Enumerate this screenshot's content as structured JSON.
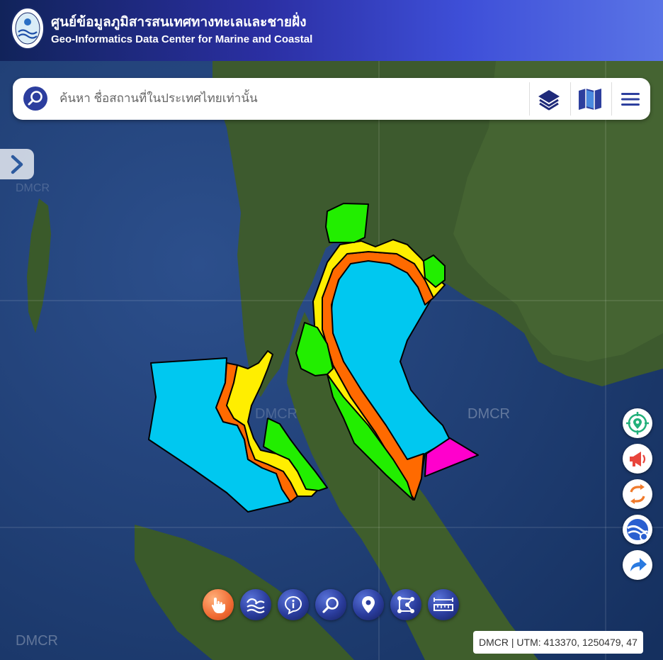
{
  "header": {
    "title_th": "ศูนย์ข้อมูลภูมิสารสนเทศทางทะเลและชายฝั่ง",
    "title_en": "Geo-Informatics Data Center for Marine and Coastal"
  },
  "search": {
    "placeholder": "ค้นหา ชื่อสถานที่ในประเทศไทยเท่านั้น",
    "value": ""
  },
  "watermark": "DMCR",
  "status": {
    "coordinates": "DMCR | UTM: 413370, 1250479, 47"
  },
  "colors": {
    "zone_offshore": "#00c8f0",
    "zone_green": "#22ee00",
    "zone_yellow": "#ffee00",
    "zone_orange": "#ff6a00",
    "zone_magenta": "#ff00cc",
    "toolbar_active": "#f06b33"
  },
  "icons": {
    "search": "search-icon",
    "layers": "layers-icon",
    "basemap": "map-icon",
    "menu": "hamburger-menu-icon",
    "sidebar": "chevron-right-icon",
    "locate": "locate-pin-icon",
    "announce": "megaphone-icon",
    "swap": "refresh-swap-icon",
    "earth": "google-earth-icon",
    "share": "share-arrow-icon",
    "hand": "hand-pointer-icon",
    "waves": "waves-icon",
    "info": "info-icon",
    "zoom": "magnifier-icon",
    "place": "location-pin-icon",
    "draw": "polygon-draw-icon",
    "measure": "ruler-icon"
  }
}
